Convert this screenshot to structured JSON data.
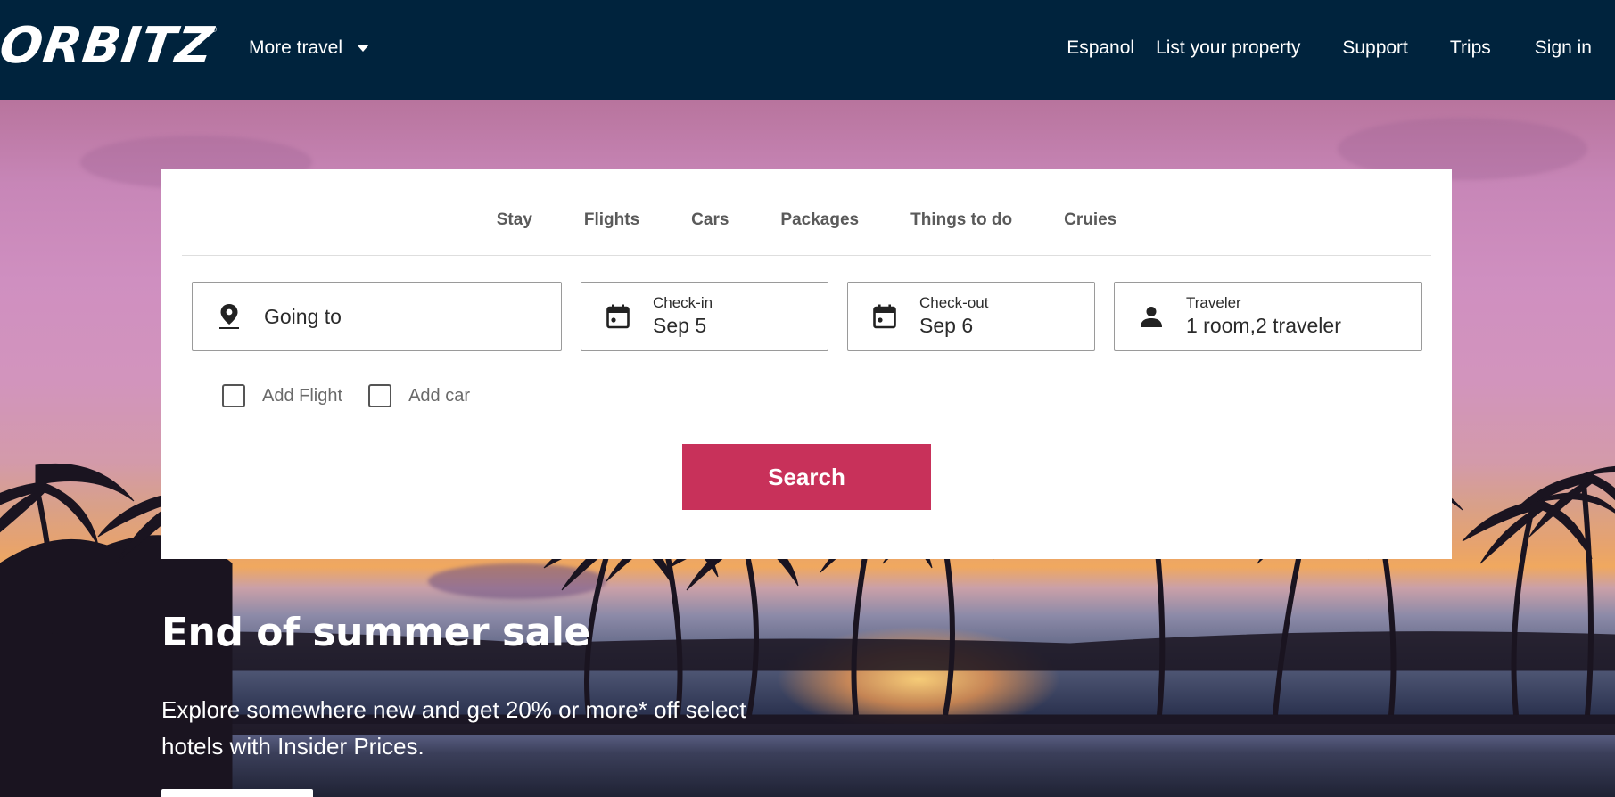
{
  "header": {
    "logo_text": "ORBITZ",
    "logo_mark": "®",
    "more_travel_label": "More travel",
    "nav": [
      "Espanol",
      "List your property",
      "Support",
      "Trips",
      "Sign in"
    ]
  },
  "search": {
    "tabs": [
      "Stay",
      "Flights",
      "Cars",
      "Packages",
      "Things to do",
      "Cruies"
    ],
    "destination": {
      "placeholder": "Going to",
      "icon": "map-pin-icon"
    },
    "check_in": {
      "label": "Check-in",
      "value": "Sep 5",
      "icon": "calendar-icon"
    },
    "check_out": {
      "label": "Check-out",
      "value": "Sep 6",
      "icon": "calendar-icon"
    },
    "traveler": {
      "label": "Traveler",
      "value": "1 room,2 traveler",
      "icon": "person-icon"
    },
    "addons": [
      "Add Flight",
      "Add car"
    ],
    "search_label": "Search"
  },
  "promo": {
    "title": "End of summer sale",
    "body": "Explore somewhere new and get 20% or more* off select hotels with Insider Prices."
  },
  "colors": {
    "header_bg": "#00233d",
    "accent": "#c8315a",
    "text_dark": "#2b2b2b",
    "tab_text": "#5a5a5a"
  }
}
